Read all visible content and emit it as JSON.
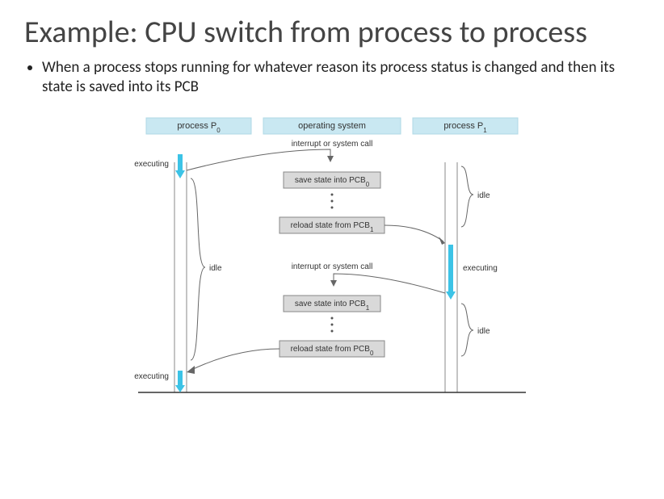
{
  "title": "Example: CPU switch from process to process",
  "bullet": "When a process stops running for whatever reason its process status is changed and then its state is saved into its PCB",
  "headers": {
    "p0": "process P",
    "p0_sub": "0",
    "os": "operating system",
    "p1": "process P",
    "p1_sub": "1"
  },
  "labels": {
    "interrupt": "interrupt or system call",
    "save0": "save state into PCB",
    "save0_sub": "0",
    "reload1": "reload state from PCB",
    "reload1_sub": "1",
    "save1": "save state into PCB",
    "save1_sub": "1",
    "reload0": "reload state from PCB",
    "reload0_sub": "0",
    "executing": "executing",
    "idle": "idle"
  }
}
